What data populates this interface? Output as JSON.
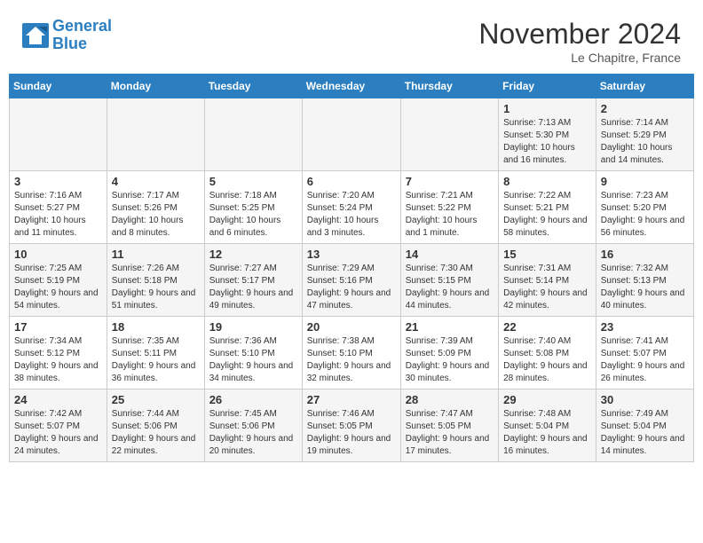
{
  "header": {
    "logo_line1": "General",
    "logo_line2": "Blue",
    "month": "November 2024",
    "location": "Le Chapitre, France"
  },
  "weekdays": [
    "Sunday",
    "Monday",
    "Tuesday",
    "Wednesday",
    "Thursday",
    "Friday",
    "Saturday"
  ],
  "weeks": [
    [
      {
        "day": "",
        "info": ""
      },
      {
        "day": "",
        "info": ""
      },
      {
        "day": "",
        "info": ""
      },
      {
        "day": "",
        "info": ""
      },
      {
        "day": "",
        "info": ""
      },
      {
        "day": "1",
        "info": "Sunrise: 7:13 AM\nSunset: 5:30 PM\nDaylight: 10 hours and 16 minutes."
      },
      {
        "day": "2",
        "info": "Sunrise: 7:14 AM\nSunset: 5:29 PM\nDaylight: 10 hours and 14 minutes."
      }
    ],
    [
      {
        "day": "3",
        "info": "Sunrise: 7:16 AM\nSunset: 5:27 PM\nDaylight: 10 hours and 11 minutes."
      },
      {
        "day": "4",
        "info": "Sunrise: 7:17 AM\nSunset: 5:26 PM\nDaylight: 10 hours and 8 minutes."
      },
      {
        "day": "5",
        "info": "Sunrise: 7:18 AM\nSunset: 5:25 PM\nDaylight: 10 hours and 6 minutes."
      },
      {
        "day": "6",
        "info": "Sunrise: 7:20 AM\nSunset: 5:24 PM\nDaylight: 10 hours and 3 minutes."
      },
      {
        "day": "7",
        "info": "Sunrise: 7:21 AM\nSunset: 5:22 PM\nDaylight: 10 hours and 1 minute."
      },
      {
        "day": "8",
        "info": "Sunrise: 7:22 AM\nSunset: 5:21 PM\nDaylight: 9 hours and 58 minutes."
      },
      {
        "day": "9",
        "info": "Sunrise: 7:23 AM\nSunset: 5:20 PM\nDaylight: 9 hours and 56 minutes."
      }
    ],
    [
      {
        "day": "10",
        "info": "Sunrise: 7:25 AM\nSunset: 5:19 PM\nDaylight: 9 hours and 54 minutes."
      },
      {
        "day": "11",
        "info": "Sunrise: 7:26 AM\nSunset: 5:18 PM\nDaylight: 9 hours and 51 minutes."
      },
      {
        "day": "12",
        "info": "Sunrise: 7:27 AM\nSunset: 5:17 PM\nDaylight: 9 hours and 49 minutes."
      },
      {
        "day": "13",
        "info": "Sunrise: 7:29 AM\nSunset: 5:16 PM\nDaylight: 9 hours and 47 minutes."
      },
      {
        "day": "14",
        "info": "Sunrise: 7:30 AM\nSunset: 5:15 PM\nDaylight: 9 hours and 44 minutes."
      },
      {
        "day": "15",
        "info": "Sunrise: 7:31 AM\nSunset: 5:14 PM\nDaylight: 9 hours and 42 minutes."
      },
      {
        "day": "16",
        "info": "Sunrise: 7:32 AM\nSunset: 5:13 PM\nDaylight: 9 hours and 40 minutes."
      }
    ],
    [
      {
        "day": "17",
        "info": "Sunrise: 7:34 AM\nSunset: 5:12 PM\nDaylight: 9 hours and 38 minutes."
      },
      {
        "day": "18",
        "info": "Sunrise: 7:35 AM\nSunset: 5:11 PM\nDaylight: 9 hours and 36 minutes."
      },
      {
        "day": "19",
        "info": "Sunrise: 7:36 AM\nSunset: 5:10 PM\nDaylight: 9 hours and 34 minutes."
      },
      {
        "day": "20",
        "info": "Sunrise: 7:38 AM\nSunset: 5:10 PM\nDaylight: 9 hours and 32 minutes."
      },
      {
        "day": "21",
        "info": "Sunrise: 7:39 AM\nSunset: 5:09 PM\nDaylight: 9 hours and 30 minutes."
      },
      {
        "day": "22",
        "info": "Sunrise: 7:40 AM\nSunset: 5:08 PM\nDaylight: 9 hours and 28 minutes."
      },
      {
        "day": "23",
        "info": "Sunrise: 7:41 AM\nSunset: 5:07 PM\nDaylight: 9 hours and 26 minutes."
      }
    ],
    [
      {
        "day": "24",
        "info": "Sunrise: 7:42 AM\nSunset: 5:07 PM\nDaylight: 9 hours and 24 minutes."
      },
      {
        "day": "25",
        "info": "Sunrise: 7:44 AM\nSunset: 5:06 PM\nDaylight: 9 hours and 22 minutes."
      },
      {
        "day": "26",
        "info": "Sunrise: 7:45 AM\nSunset: 5:06 PM\nDaylight: 9 hours and 20 minutes."
      },
      {
        "day": "27",
        "info": "Sunrise: 7:46 AM\nSunset: 5:05 PM\nDaylight: 9 hours and 19 minutes."
      },
      {
        "day": "28",
        "info": "Sunrise: 7:47 AM\nSunset: 5:05 PM\nDaylight: 9 hours and 17 minutes."
      },
      {
        "day": "29",
        "info": "Sunrise: 7:48 AM\nSunset: 5:04 PM\nDaylight: 9 hours and 16 minutes."
      },
      {
        "day": "30",
        "info": "Sunrise: 7:49 AM\nSunset: 5:04 PM\nDaylight: 9 hours and 14 minutes."
      }
    ]
  ]
}
